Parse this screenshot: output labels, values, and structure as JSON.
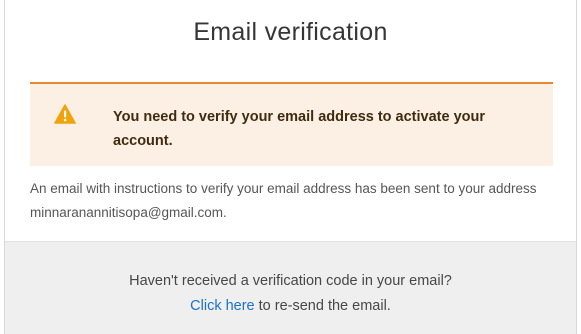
{
  "page": {
    "title": "Email verification"
  },
  "alert": {
    "icon": "warning-triangle-icon",
    "message": "You need to verify your email address to activate your account.",
    "accent_color": "#e8892d",
    "background_color": "#fcefe3"
  },
  "info": {
    "text": "An email with instructions to verify your email address has been sent to your address minnaranannitisopa@gmail.com."
  },
  "footer": {
    "question": "Haven't received a verification code in your email?",
    "link_label": "Click here",
    "link_suffix": " to re-send the email.",
    "link_color": "#1a73c7"
  }
}
